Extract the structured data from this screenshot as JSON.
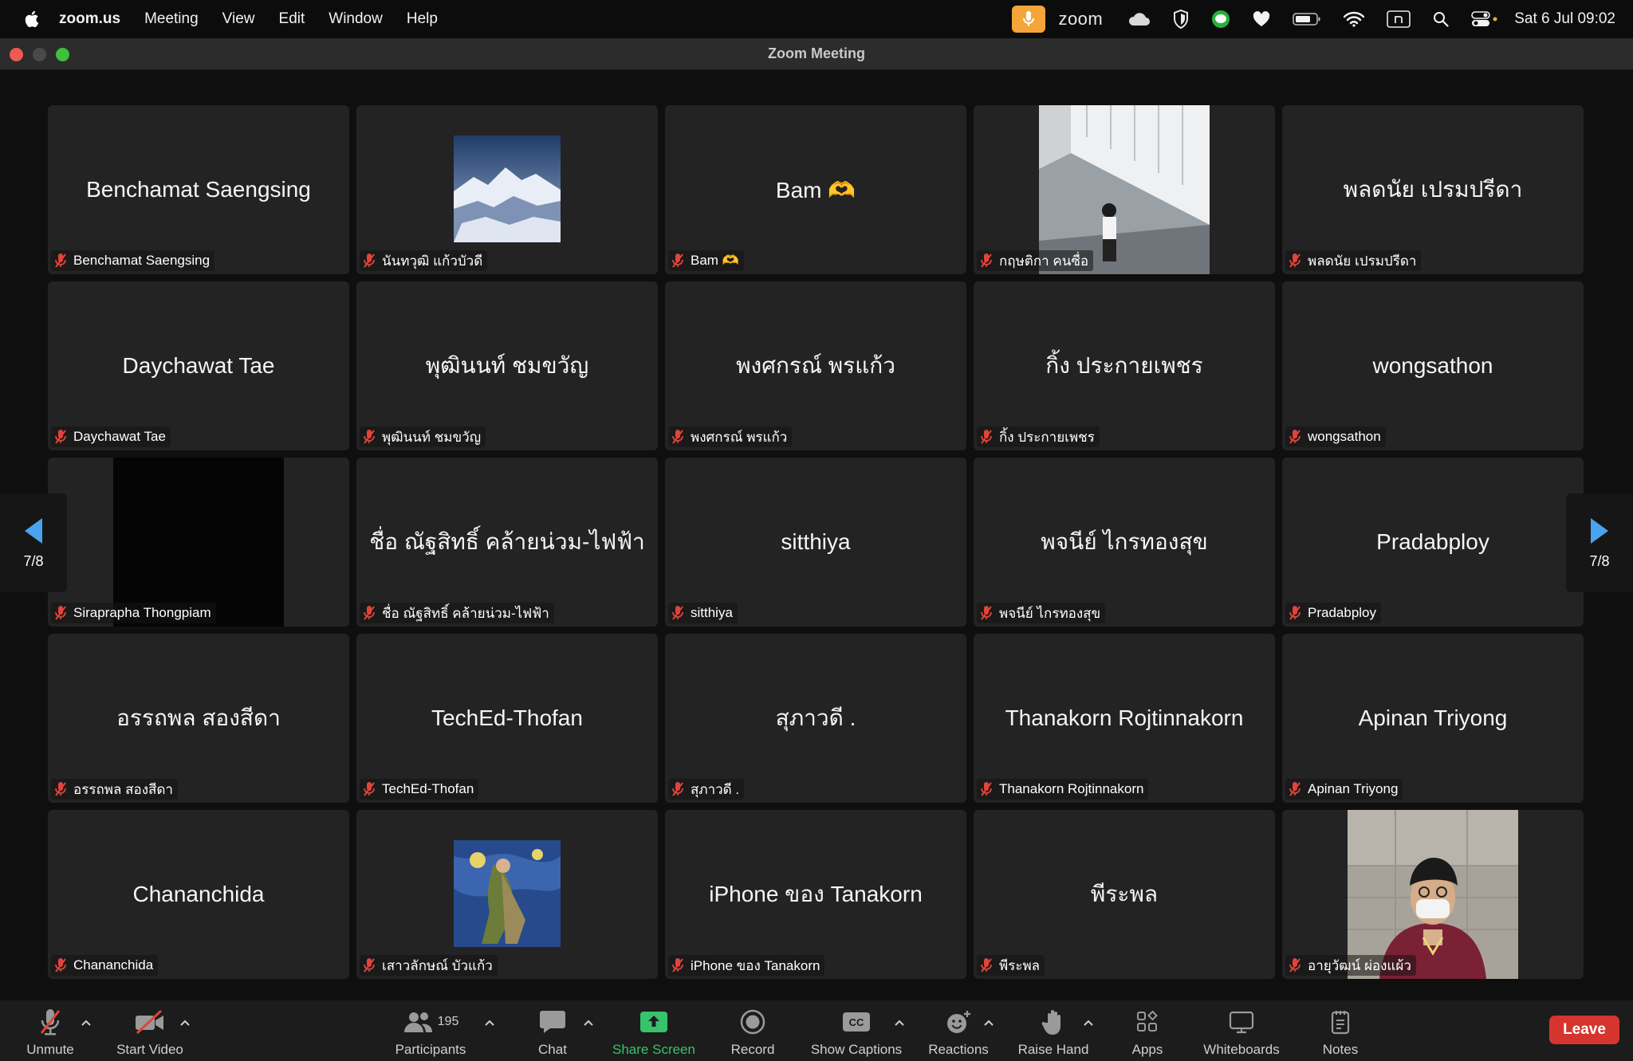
{
  "menubar": {
    "app": "zoom.us",
    "items": [
      "Meeting",
      "View",
      "Edit",
      "Window",
      "Help"
    ],
    "zoom_word": "zoom",
    "clock": "Sat 6 Jul  09:02"
  },
  "window": {
    "title": "Zoom Meeting"
  },
  "gallery": {
    "page_indicator": "7/8",
    "tiles": [
      {
        "display": "Benchamat Saengsing",
        "label": "Benchamat Saengsing"
      },
      {
        "display": "",
        "label": "นันทวุฒิ แก้วบัวดี"
      },
      {
        "display": "Bam 🫶",
        "label": "Bam 🫶"
      },
      {
        "display": "",
        "label": "กฤษติกา คนซื่อ"
      },
      {
        "display": "พลดนัย เปรมปรีดา",
        "label": "พลดนัย เปรมปรีดา"
      },
      {
        "display": "Daychawat Tae",
        "label": "Daychawat Tae"
      },
      {
        "display": "พุฒินนท์ ชมขวัญ",
        "label": "พุฒินนท์ ชมขวัญ"
      },
      {
        "display": "พงศกรณ์ พรแก้ว",
        "label": "พงศกรณ์ พรแก้ว"
      },
      {
        "display": "กิ้ง ประกายเพชร",
        "label": "กิ้ง ประกายเพชร"
      },
      {
        "display": "wongsathon",
        "label": "wongsathon"
      },
      {
        "display": "",
        "label": "Siraprapha Thongpiam"
      },
      {
        "display": "ชื่อ ณัฐสิทธิ์ คล้ายน่วม-ไฟฟ้า",
        "label": "ชื่อ ณัฐสิทธิ์ คล้ายน่วม-ไฟฟ้า"
      },
      {
        "display": "sitthiya",
        "label": "sitthiya"
      },
      {
        "display": "พจนีย์ ไกรทองสุข",
        "label": "พจนีย์ ไกรทองสุข"
      },
      {
        "display": "Pradabploy",
        "label": "Pradabploy"
      },
      {
        "display": "อรรถพล สองสีดา",
        "label": "อรรถพล สองสีดา"
      },
      {
        "display": "TechEd-Thofan",
        "label": "TechEd-Thofan"
      },
      {
        "display": "สุภาวดี .",
        "label": "สุภาวดี ."
      },
      {
        "display": "Thanakorn Rojtinnakorn",
        "label": "Thanakorn Rojtinnakorn"
      },
      {
        "display": "Apinan Triyong",
        "label": "Apinan Triyong"
      },
      {
        "display": "Chananchida",
        "label": "Chananchida"
      },
      {
        "display": "",
        "label": "เสาวลักษณ์ บัวแก้ว"
      },
      {
        "display": "iPhone ของ Tanakorn",
        "label": "iPhone ของ Tanakorn"
      },
      {
        "display": "พีระพล",
        "label": "พีระพล"
      },
      {
        "display": "",
        "label": "อายุวัฒน์ ผ่องแผ้ว"
      }
    ]
  },
  "toolbar": {
    "unmute": "Unmute",
    "start_video": "Start Video",
    "participants": "Participants",
    "participant_count": "195",
    "chat": "Chat",
    "share_screen": "Share Screen",
    "record": "Record",
    "show_captions": "Show Captions",
    "reactions": "Reactions",
    "raise_hand": "Raise Hand",
    "apps": "Apps",
    "whiteboards": "Whiteboards",
    "notes": "Notes",
    "leave": "Leave"
  },
  "colors": {
    "accent_blue": "#4aa3f0",
    "mute_red": "#e0443a",
    "share_green": "#35c36b",
    "leave_red": "#d6342e"
  }
}
